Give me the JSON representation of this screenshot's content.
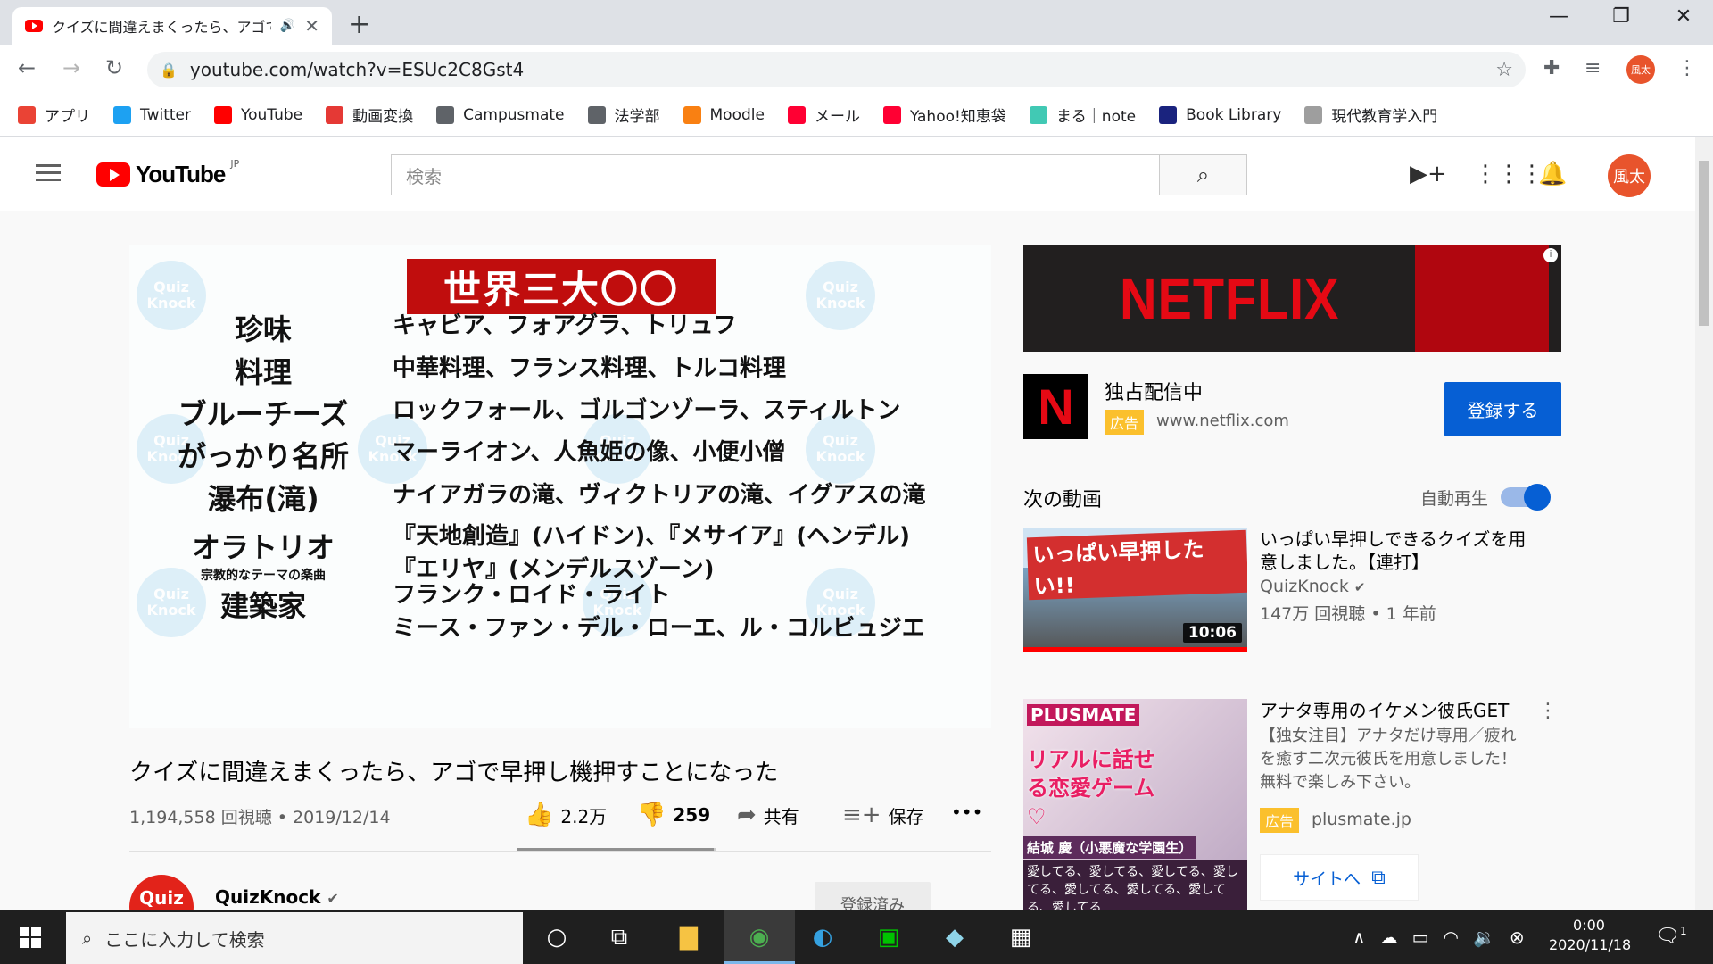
{
  "browser": {
    "tab_title": "クイズに間違えまくったら、アゴで早押し機押すことになった",
    "url": "youtube.com/watch?v=ESUc2C8Gst4",
    "profile_initials": "風太",
    "bookmarks": [
      {
        "label": "アプリ",
        "icon": "apps-grid-icon",
        "color": "#ea4335"
      },
      {
        "label": "Twitter",
        "icon": "twitter-icon",
        "color": "#1da1f2"
      },
      {
        "label": "YouTube",
        "icon": "youtube-icon",
        "color": "#ff0000"
      },
      {
        "label": "動画変換",
        "icon": "download-icon",
        "color": "#e53935"
      },
      {
        "label": "Campusmate",
        "icon": "globe-icon",
        "color": "#5f6368"
      },
      {
        "label": "法学部",
        "icon": "globe-icon",
        "color": "#5f6368"
      },
      {
        "label": "Moodle",
        "icon": "moodle-icon",
        "color": "#f98012"
      },
      {
        "label": "メール",
        "icon": "yahoo-icon",
        "color": "#ff0033"
      },
      {
        "label": "Yahoo!知恵袋",
        "icon": "yahoo-icon",
        "color": "#ff0033"
      },
      {
        "label": "まる｜note",
        "icon": "note-icon",
        "color": "#41c9b4"
      },
      {
        "label": "Book Library",
        "icon": "library-icon",
        "color": "#1a237e"
      },
      {
        "label": "現代教育学入門",
        "icon": "course-icon",
        "color": "#9e9e9e"
      }
    ]
  },
  "youtube": {
    "logo_text": "YouTube",
    "region": "JP",
    "search_placeholder": "検索",
    "avatar": "風太"
  },
  "video": {
    "header": "世界三大〇〇",
    "rows": [
      {
        "category": "珍味",
        "items": "キャビア、フォアグラ、トリュフ"
      },
      {
        "category": "料理",
        "items": "中華料理、フランス料理、トルコ料理"
      },
      {
        "category": "ブルーチーズ",
        "items": "ロックフォール、ゴルゴンゾーラ、スティルトン"
      },
      {
        "category": "がっかり名所",
        "items": "マーライオン、人魚姫の像、小便小僧"
      },
      {
        "category": "瀑布(滝)",
        "items": "ナイアガラの滝、ヴィクトリアの滝、イグアスの滝"
      },
      {
        "category": "オラトリオ",
        "sub": "宗教的なテーマの楽曲",
        "items": "『天地創造』(ハイドン)、『メサイア』(ヘンデル)",
        "items2": "『エリヤ』(メンデルスゾーン)"
      },
      {
        "category": "建築家",
        "items": "フランク・ロイド・ライト",
        "items2": "ミース・ファン・デル・ローエ、ル・コルビュジエ"
      }
    ],
    "watermark": "Quiz Knock",
    "title": "クイズに間違えまくったら、アゴで早押し機押すことになった",
    "views_date": "1,194,558 回視聴 • 2019/12/14",
    "likes": "2.2万",
    "dislikes": "259",
    "share": "共有",
    "save": "保存",
    "more": "•••",
    "like_ratio": 0.99,
    "channel": "QuizKnock",
    "channel_avatar": "Quiz",
    "subscribed_label": "登録済み"
  },
  "sidebar": {
    "ad": {
      "banner_text": "NETFLIX",
      "logo_letter": "N",
      "title": "独占配信中",
      "badge": "広告",
      "domain": "www.netflix.com",
      "cta": "登録する"
    },
    "next_label": "次の動画",
    "autoplay_label": "自動再生",
    "autoplay_on": true,
    "recommendations": [
      {
        "title": "いっぱい早押しできるクイズを用意しました。【連打】",
        "channel": "QuizKnock",
        "meta": "147万 回視聴 • 1 年前",
        "duration": "10:06",
        "thumb_text": "いっぱい早押したい!!"
      }
    ],
    "ad2": {
      "title": "アナタ専用のイケメン彼氏GET",
      "desc": "【独女注目】アナタだけ専用／疲れを癒す二次元彼氏を用意しました！無料で楽しみ下さい。",
      "badge": "広告",
      "domain": "plusmate.jp",
      "cta": "サイトへ",
      "thumb_brand": "PLUSMATE",
      "thumb_tag": "リアルに話せる恋愛ゲーム♡",
      "thumb_name": "結城 慶（小悪魔な学園生）",
      "thumb_stripe": "愛してる、愛してる、愛してる、愛してる、愛してる、愛してる、愛してる、愛してる"
    }
  },
  "taskbar": {
    "search_placeholder": "ここに入力して検索",
    "time": "0:00",
    "date": "2020/11/18",
    "notifications": "1"
  }
}
